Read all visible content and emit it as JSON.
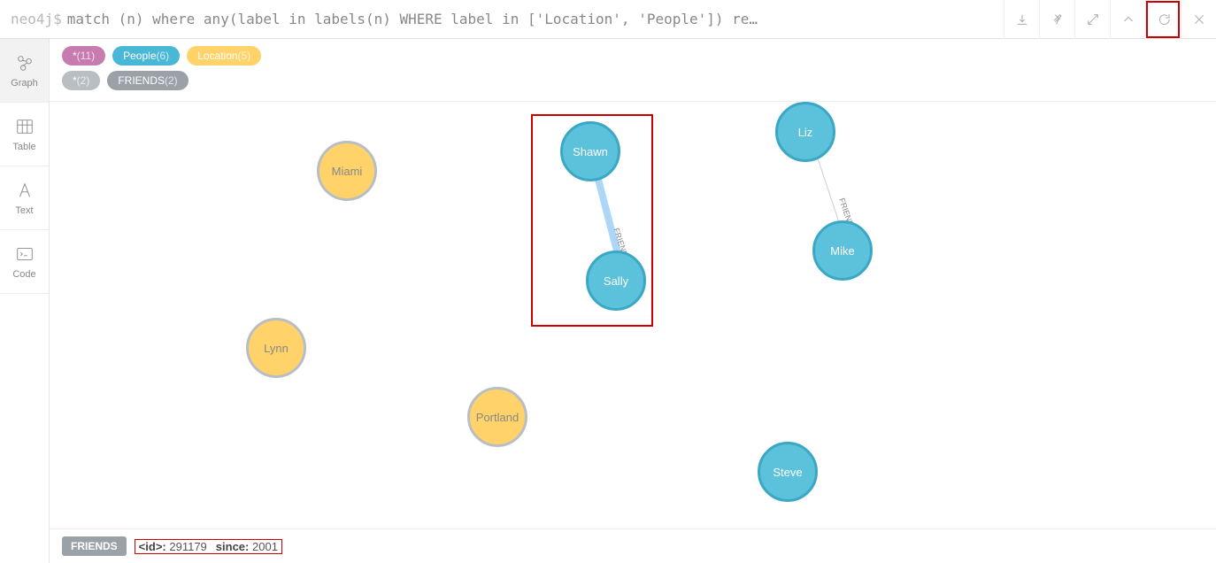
{
  "prompt": "neo4j$",
  "query": "match (n) where any(label in labels(n) WHERE label in ['Location', 'People']) re…",
  "sidebar": {
    "items": [
      {
        "label": "Graph"
      },
      {
        "label": "Table"
      },
      {
        "label": "Text"
      },
      {
        "label": "Code"
      }
    ]
  },
  "legend": {
    "row1": [
      {
        "label": "*",
        "count": "(11)",
        "style": "magenta"
      },
      {
        "label": "People",
        "count": "(6)",
        "style": "blue"
      },
      {
        "label": "Location",
        "count": "(5)",
        "style": "yellow"
      }
    ],
    "row2": [
      {
        "label": "*",
        "count": "(2)",
        "style": "grey-light"
      },
      {
        "label": "FRIENDS",
        "count": "(2)",
        "style": "grey"
      }
    ]
  },
  "nodes": {
    "miami": "Miami",
    "lynn": "Lynn",
    "portland": "Portland",
    "shawn": "Shawn",
    "sally": "Sally",
    "liz": "Liz",
    "mike": "Mike",
    "steve": "Steve"
  },
  "edges": {
    "friends_label": "FRIENDS"
  },
  "footer": {
    "badge": "FRIENDS",
    "id_key": "<id>:",
    "id_val": "291179",
    "since_key": "since:",
    "since_val": "2001"
  }
}
